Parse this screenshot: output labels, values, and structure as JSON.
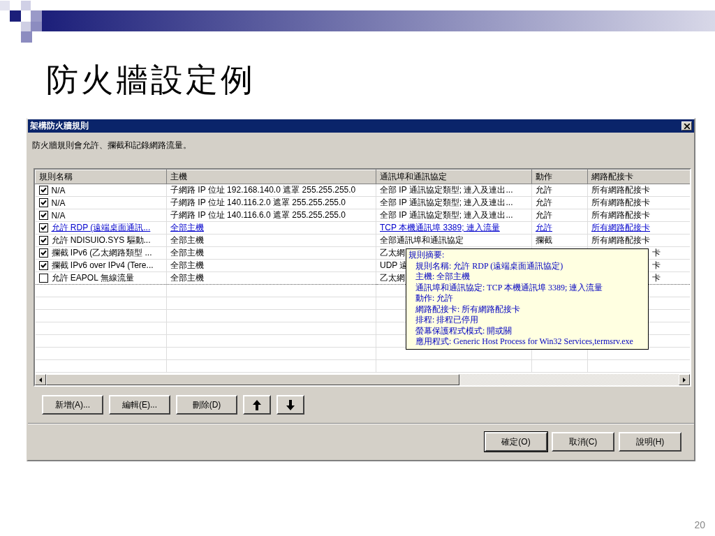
{
  "slide": {
    "title": "防火牆設定例",
    "page_number": "20"
  },
  "window": {
    "title": "架構防火牆規則",
    "description": "防火牆規則會允許、攔截和記錄網路流量。"
  },
  "table": {
    "columns": [
      "規則名稱",
      "主機",
      "通訊埠和通訊協定",
      "動作",
      "網路配接卡"
    ],
    "rows": [
      {
        "checked": true,
        "hovered": false,
        "focused": false,
        "cells": [
          "N/A",
          "子網路 IP 位址 192.168.140.0 遮罩 255.255.255.0",
          "全部 IP 通訊協定類型; 連入及連出...",
          "允許",
          "所有網路配接卡"
        ]
      },
      {
        "checked": true,
        "hovered": false,
        "focused": false,
        "cells": [
          "N/A",
          "子網路 IP 位址 140.116.2.0 遮罩 255.255.255.0",
          "全部 IP 通訊協定類型; 連入及連出...",
          "允許",
          "所有網路配接卡"
        ]
      },
      {
        "checked": true,
        "hovered": false,
        "focused": false,
        "cells": [
          "N/A",
          "子網路 IP 位址 140.116.6.0 遮罩 255.255.255.0",
          "全部 IP 通訊協定類型; 連入及連出...",
          "允許",
          "所有網路配接卡"
        ]
      },
      {
        "checked": true,
        "hovered": true,
        "focused": false,
        "cells": [
          "允許 RDP (遠端桌面通訊...",
          "全部主機",
          "TCP 本機通訊埠 3389; 連入流量",
          "允許",
          "所有網路配接卡"
        ]
      },
      {
        "checked": true,
        "hovered": false,
        "focused": false,
        "cells": [
          "允許 NDISUIO.SYS 驅動...",
          "全部主機",
          "全部通訊埠和通訊協定",
          "攔截",
          "所有網路配接卡"
        ]
      },
      {
        "checked": true,
        "hovered": false,
        "focused": false,
        "cells": [
          "攔截 IPv6 (乙太網路類型 ...",
          "全部主機",
          "乙太網"
        ],
        "tail": "卡"
      },
      {
        "checked": true,
        "hovered": false,
        "focused": false,
        "cells": [
          "攔截 IPv6 over IPv4 (Tere...",
          "全部主機",
          "UDP 遠"
        ],
        "tail": "卡"
      },
      {
        "checked": false,
        "hovered": false,
        "focused": true,
        "cells": [
          "允許 EAPOL 無線流量",
          "全部主機",
          "乙太網"
        ],
        "tail": "卡"
      }
    ]
  },
  "tooltip": {
    "heading": "規則摘要:",
    "lines": [
      "規則名稱: 允許 RDP (遠端桌面通訊協定)",
      "主機: 全部主機",
      "通訊埠和通訊協定: TCP 本機通訊埠 3389; 連入流量",
      "動作: 允許",
      "網路配接卡: 所有網路配接卡",
      "排程: 排程已停用",
      "螢幕保護程式模式: 開或關",
      "應用程式: Generic Host Process for Win32 Services,termsrv.exe"
    ]
  },
  "buttons": [
    {
      "kind": "text",
      "label": "新增(A)..."
    },
    {
      "kind": "text",
      "label": "編輯(E)..."
    },
    {
      "kind": "text",
      "label": "刪除(D)"
    },
    {
      "kind": "arrow-up"
    },
    {
      "kind": "arrow-down"
    }
  ],
  "dialog_buttons": [
    {
      "label": "確定(O)",
      "default": true
    },
    {
      "label": "取消(C)",
      "default": false
    },
    {
      "label": "說明(H)",
      "default": false
    }
  ]
}
